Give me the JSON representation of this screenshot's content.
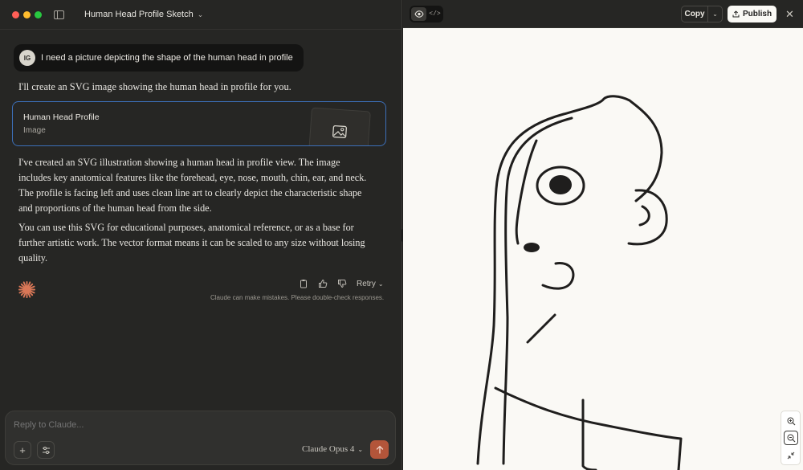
{
  "window": {
    "title": "Human Head Profile Sketch"
  },
  "conversation": {
    "user_initials": "IG",
    "user_message": "I need a picture depicting the shape of the human head in profile",
    "assistant_intro": "I'll create an SVG image showing the human head in profile for you.",
    "artifact": {
      "title": "Human Head Profile",
      "type": "Image"
    },
    "paragraphs": [
      "I've created an SVG illustration showing a human head in profile view. The image includes key anatomical features like the forehead, eye, nose, mouth, chin, ear, and neck. The profile is facing left and uses clean line art to clearly depict the characteristic shape and proportions of the human head from the side.",
      "You can use this SVG for educational purposes, anatomical reference, or as a base for further artistic work. The vector format means it can be scaled to any size without losing quality."
    ],
    "retry_label": "Retry",
    "disclaimer": "Claude can make mistakes. Please double-check responses."
  },
  "composer": {
    "placeholder": "Reply to Claude...",
    "model": "Claude Opus 4"
  },
  "artifact_panel": {
    "copy_label": "Copy",
    "publish_label": "Publish"
  },
  "colors": {
    "accent_blue": "#3c6fb8",
    "send_orange": "#b3553a",
    "claude_orange": "#d97757"
  }
}
